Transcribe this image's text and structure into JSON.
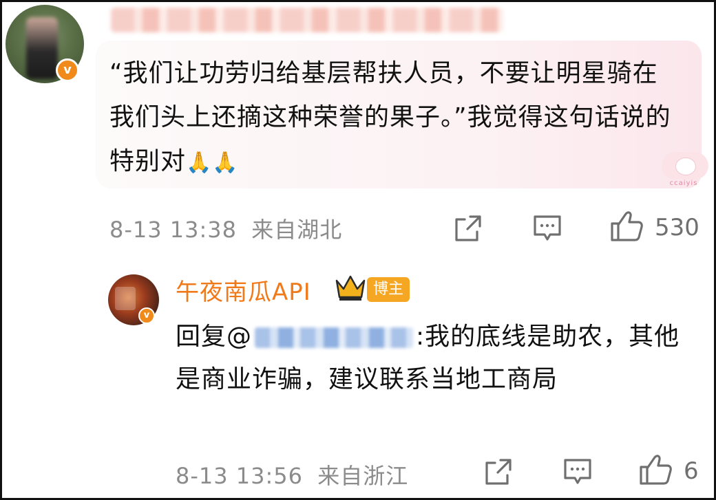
{
  "comment1": {
    "text": "“我们让功劳归给基层帮扶人员，不要让明星骑在我们头上还摘这种荣誉的果子。”我觉得这句话说的特别对",
    "emoji": "🙏🙏",
    "date": "8-13 13:38",
    "location": "来自湖北",
    "likes": "530",
    "sticker_caption": "ccaiyis"
  },
  "comment2": {
    "username": "午夜南瓜API",
    "role_tag": "博主",
    "reply_prefix": "回复@",
    "reply_text": ":我的底线是助农，其他是商业诈骗，建议联系当地工商局",
    "date": "8-13 13:56",
    "location": "来自浙江",
    "likes": "6"
  },
  "badge_v": "v",
  "colors": {
    "accent_orange": "#f07a1a",
    "tag_bg": "#f5a623",
    "meta_gray": "#8b8b8b"
  },
  "icons": [
    "share-icon",
    "comment-icon",
    "like-icon",
    "crown-icon",
    "verified-badge-icon"
  ]
}
